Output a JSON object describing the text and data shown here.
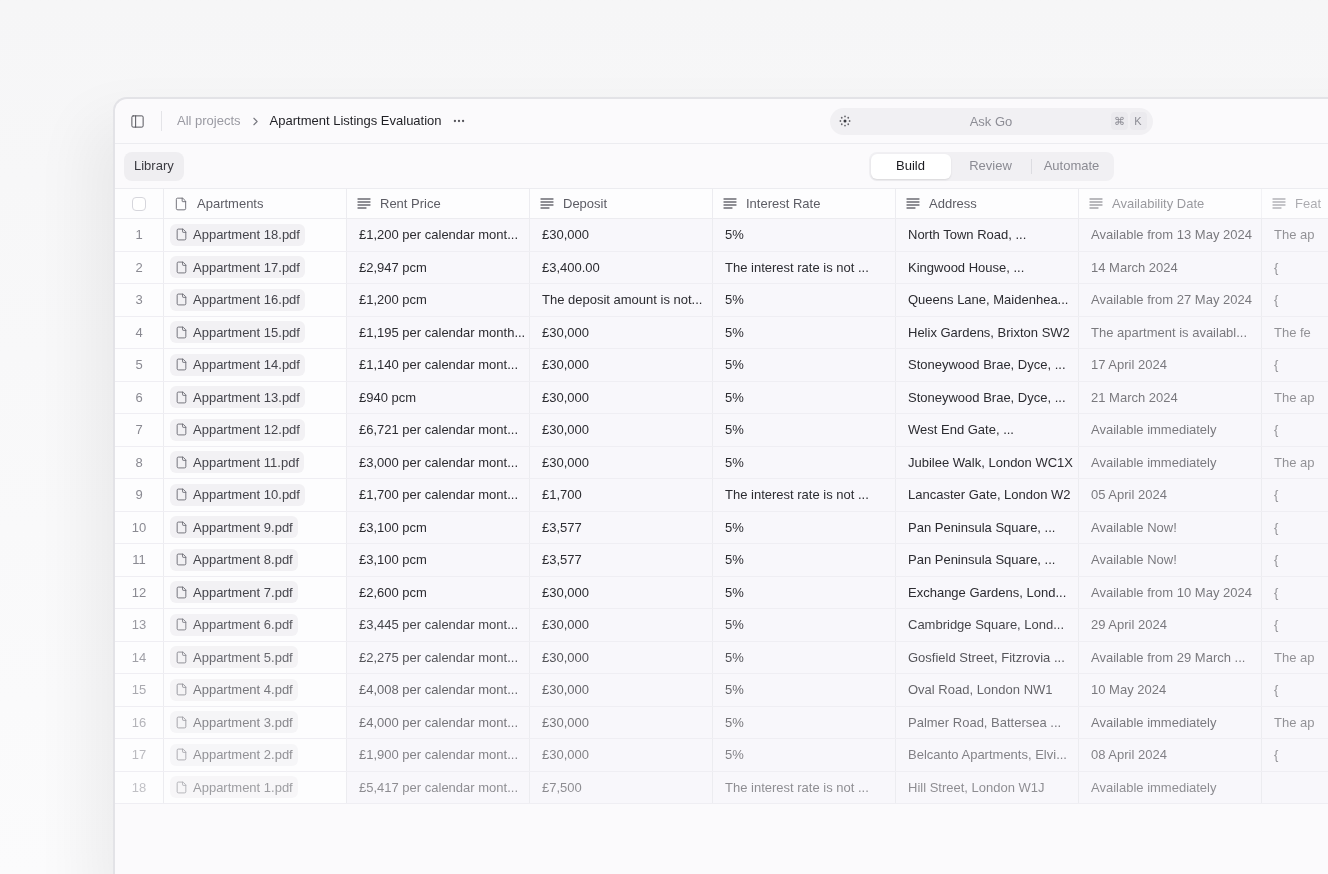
{
  "toolbar": {
    "breadcrumb": [
      {
        "label": "All projects",
        "current": false
      },
      {
        "label": "Apartment Listings Evaluation",
        "current": true
      }
    ],
    "search": {
      "placeholder": "Ask Go",
      "shortcut": [
        "⌘",
        "K"
      ]
    }
  },
  "library_button": "Library",
  "view_tabs": [
    {
      "label": "Build",
      "selected": true
    },
    {
      "label": "Review",
      "selected": false
    },
    {
      "label": "Automate",
      "selected": false
    }
  ],
  "table": {
    "columns": [
      {
        "kind": "select",
        "checked": false
      },
      {
        "label": "Apartments",
        "kind": "file"
      },
      {
        "label": "Rent Price",
        "kind": "text"
      },
      {
        "label": "Deposit",
        "kind": "text"
      },
      {
        "label": "Interest Rate",
        "kind": "text"
      },
      {
        "label": "Address",
        "kind": "text"
      },
      {
        "label": "Availability Date",
        "kind": "text"
      },
      {
        "label": "Feat",
        "kind": "text"
      }
    ],
    "rows": [
      {
        "cells": [
          "1",
          "Appartment 18.pdf",
          "£1,200 per calendar mont...",
          "£30,000",
          "5%",
          "North Town Road, ...",
          "Available from 13 May 2024",
          "The ap"
        ]
      },
      {
        "cells": [
          "2",
          "Appartment 17.pdf",
          "£2,947 pcm",
          "£3,400.00",
          "The interest rate is not ...",
          "Kingwood House, ...",
          "14 March 2024",
          "{"
        ]
      },
      {
        "cells": [
          "3",
          "Appartment 16.pdf",
          "£1,200 pcm",
          "The deposit amount is not...",
          "5%",
          "Queens Lane, Maidenhea...",
          "Available from 27 May 2024",
          "{"
        ]
      },
      {
        "cells": [
          "4",
          "Appartment 15.pdf",
          "£1,195 per calendar month...",
          "£30,000",
          "5%",
          "Helix Gardens, Brixton SW2",
          "The apartment is availabl...",
          "The fe"
        ]
      },
      {
        "cells": [
          "5",
          "Appartment 14.pdf",
          "£1,140 per calendar mont...",
          "£30,000",
          "5%",
          "Stoneywood Brae, Dyce, ...",
          "17 April 2024",
          "{"
        ]
      },
      {
        "cells": [
          "6",
          "Appartment 13.pdf",
          "£940 pcm",
          "£30,000",
          "5%",
          "Stoneywood Brae, Dyce, ...",
          "21 March 2024",
          "The ap"
        ]
      },
      {
        "cells": [
          "7",
          "Appartment 12.pdf",
          "£6,721 per calendar mont...",
          "£30,000",
          "5%",
          "West End Gate, ...",
          "Available immediately",
          "{"
        ]
      },
      {
        "cells": [
          "8",
          "Appartment 11.pdf",
          "£3,000 per calendar mont...",
          "£30,000",
          "5%",
          "Jubilee Walk, London WC1X",
          "Available immediately",
          "The ap"
        ]
      },
      {
        "cells": [
          "9",
          "Appartment 10.pdf",
          "£1,700 per calendar mont...",
          "£1,700",
          "The interest rate is not ...",
          "Lancaster Gate, London W2",
          "05 April 2024",
          "{"
        ]
      },
      {
        "cells": [
          "10",
          "Appartment 9.pdf",
          "£3,100 pcm",
          "£3,577",
          "5%",
          "Pan Peninsula Square, ...",
          "Available Now!",
          "{"
        ]
      },
      {
        "cells": [
          "11",
          "Appartment 8.pdf",
          "£3,100 pcm",
          "£3,577",
          "5%",
          "Pan Peninsula Square, ...",
          "Available Now!",
          "{"
        ]
      },
      {
        "cells": [
          "12",
          "Appartment 7.pdf",
          "£2,600 pcm",
          "£30,000",
          "5%",
          "Exchange Gardens, Lond...",
          "Available from 10 May 2024",
          "{"
        ]
      },
      {
        "cells": [
          "13",
          "Appartment 6.pdf",
          "£3,445 per calendar mont...",
          "£30,000",
          "5%",
          "Cambridge Square, Lond...",
          "29 April 2024",
          "{"
        ]
      },
      {
        "cells": [
          "14",
          "Appartment 5.pdf",
          "£2,275 per calendar mont...",
          "£30,000",
          "5%",
          "Gosfield Street, Fitzrovia ...",
          "Available from 29 March ...",
          "The ap"
        ]
      },
      {
        "cells": [
          "15",
          "Appartment 4.pdf",
          "£4,008 per calendar mont...",
          "£30,000",
          "5%",
          "Oval Road, London NW1",
          "10 May 2024",
          "{"
        ]
      },
      {
        "cells": [
          "16",
          "Appartment 3.pdf",
          "£4,000 per calendar mont...",
          "£30,000",
          "5%",
          "Palmer Road, Battersea ...",
          "Available immediately",
          "The ap"
        ]
      },
      {
        "cells": [
          "17",
          "Appartment 2.pdf",
          "£1,900 per calendar mont...",
          "£30,000",
          "5%",
          "Belcanto Apartments, Elvi...",
          "08 April 2024",
          "{"
        ]
      },
      {
        "cells": [
          "18",
          "Appartment 1.pdf",
          "£5,417 per calendar mont...",
          "£7,500",
          "The interest rate is not ...",
          "Hill Street, London W1J",
          "Available immediately"
        ]
      }
    ]
  }
}
